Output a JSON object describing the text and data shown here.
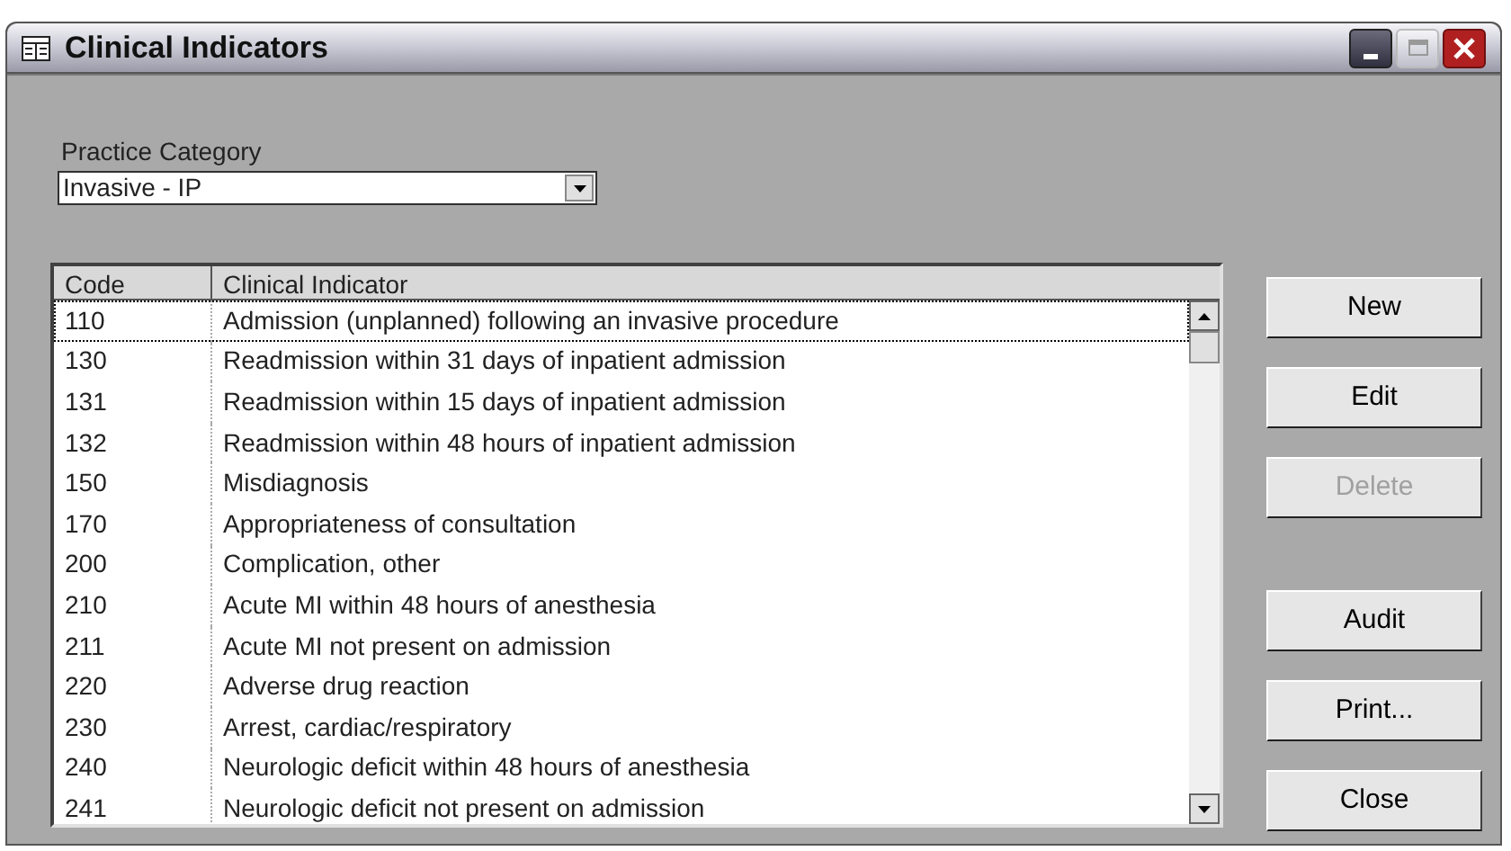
{
  "window": {
    "title": "Clinical Indicators"
  },
  "category": {
    "label": "Practice Category",
    "value": "Invasive - IP"
  },
  "table": {
    "columns": [
      "Code",
      "Clinical Indicator"
    ],
    "rows": [
      {
        "code": "110",
        "indicator": "Admission (unplanned) following an invasive procedure",
        "selected": true
      },
      {
        "code": "130",
        "indicator": "Readmission within 31 days of inpatient admission",
        "selected": false
      },
      {
        "code": "131",
        "indicator": "Readmission within 15 days of inpatient admission",
        "selected": false
      },
      {
        "code": "132",
        "indicator": "Readmission within 48 hours of inpatient admission",
        "selected": false
      },
      {
        "code": "150",
        "indicator": "Misdiagnosis",
        "selected": false
      },
      {
        "code": "170",
        "indicator": "Appropriateness of consultation",
        "selected": false
      },
      {
        "code": "200",
        "indicator": "Complication, other",
        "selected": false
      },
      {
        "code": "210",
        "indicator": "Acute MI within 48 hours of anesthesia",
        "selected": false
      },
      {
        "code": "211",
        "indicator": "Acute MI not present on admission",
        "selected": false
      },
      {
        "code": "220",
        "indicator": "Adverse drug reaction",
        "selected": false
      },
      {
        "code": "230",
        "indicator": "Arrest, cardiac/respiratory",
        "selected": false
      },
      {
        "code": "240",
        "indicator": "Neurologic deficit within 48 hours of anesthesia",
        "selected": false
      },
      {
        "code": "241",
        "indicator": "Neurologic deficit not present on admission",
        "selected": false
      }
    ]
  },
  "record_buttons": [
    {
      "label": "New",
      "disabled": false
    },
    {
      "label": "Edit",
      "disabled": false
    },
    {
      "label": "Delete",
      "disabled": true
    }
  ],
  "other_buttons": [
    {
      "label": "Audit",
      "disabled": false
    },
    {
      "label": "Print...",
      "disabled": false
    },
    {
      "label": "Close",
      "disabled": false
    }
  ]
}
